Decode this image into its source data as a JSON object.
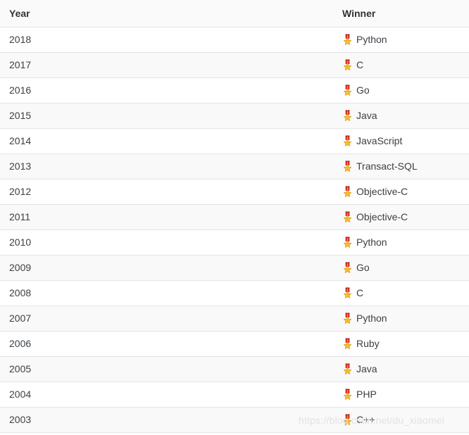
{
  "table": {
    "columns": [
      {
        "key": "year",
        "label": "Year"
      },
      {
        "key": "winner",
        "label": "Winner"
      }
    ],
    "icon": {
      "name": "medal-icon",
      "glyph": "🎖",
      "star_color": "#f5bc34",
      "ribbon_color": "#d93025"
    },
    "rows": [
      {
        "year": "2018",
        "winner": "Python"
      },
      {
        "year": "2017",
        "winner": "C"
      },
      {
        "year": "2016",
        "winner": "Go"
      },
      {
        "year": "2015",
        "winner": "Java"
      },
      {
        "year": "2014",
        "winner": "JavaScript"
      },
      {
        "year": "2013",
        "winner": "Transact-SQL"
      },
      {
        "year": "2012",
        "winner": "Objective-C"
      },
      {
        "year": "2011",
        "winner": "Objective-C"
      },
      {
        "year": "2010",
        "winner": "Python"
      },
      {
        "year": "2009",
        "winner": "Go"
      },
      {
        "year": "2008",
        "winner": "C"
      },
      {
        "year": "2007",
        "winner": "Python"
      },
      {
        "year": "2006",
        "winner": "Ruby"
      },
      {
        "year": "2005",
        "winner": "Java"
      },
      {
        "year": "2004",
        "winner": "PHP"
      },
      {
        "year": "2003",
        "winner": "C++"
      }
    ]
  },
  "watermark": {
    "text": "https://blog.csdn.net/du_xiaomei",
    "color": "#e2e2e2"
  },
  "colors": {
    "header_background": "#fafafa",
    "row_background": "#ffffff",
    "row_stripe_background": "#f9f9f9",
    "border": "#e4e4e4",
    "text": "#3b4045",
    "header_text": "#2f3337"
  }
}
